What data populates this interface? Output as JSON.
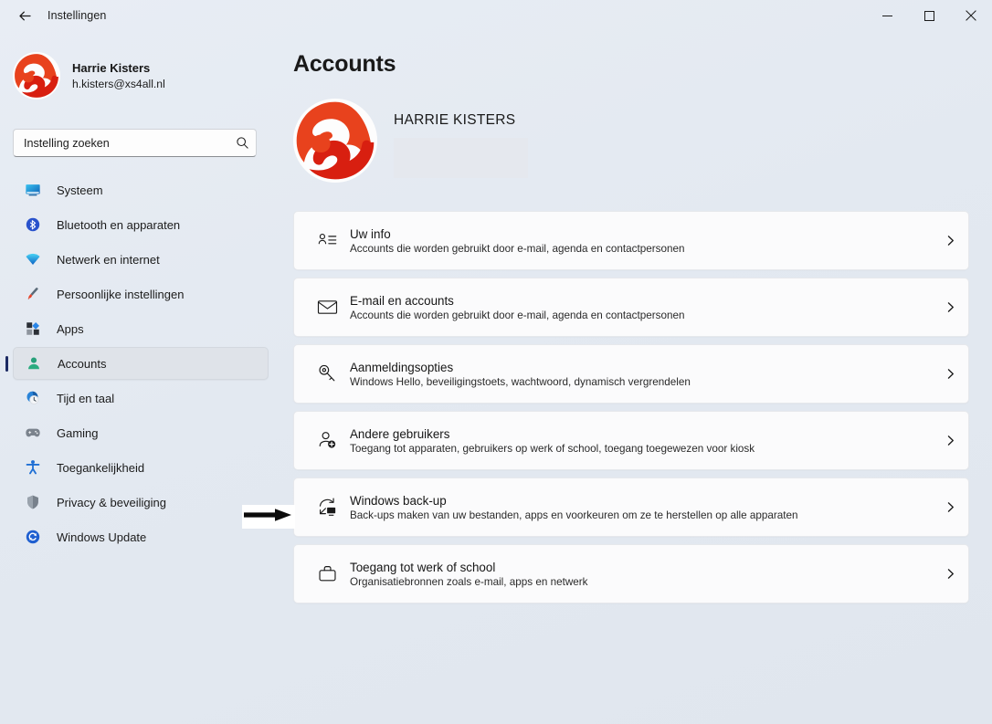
{
  "window": {
    "title": "Instellingen",
    "back_icon": "back-arrow-icon",
    "minimize_label": "Minimaliseren",
    "maximize_label": "Maximaliseren",
    "close_label": "Sluiten"
  },
  "sidebar": {
    "account": {
      "name": "Harrie Kisters",
      "email": "h.kisters@xs4all.nl",
      "avatar_icon": "user-avatar-logo"
    },
    "search": {
      "placeholder": "Instelling zoeken",
      "value": "",
      "icon": "search-icon"
    },
    "items": [
      {
        "label": "Systeem",
        "icon": "monitor-icon",
        "selected": false
      },
      {
        "label": "Bluetooth en apparaten",
        "icon": "bluetooth-icon",
        "selected": false
      },
      {
        "label": "Netwerk en internet",
        "icon": "wifi-icon",
        "selected": false
      },
      {
        "label": "Persoonlijke instellingen",
        "icon": "paintbrush-icon",
        "selected": false
      },
      {
        "label": "Apps",
        "icon": "apps-grid-icon",
        "selected": false
      },
      {
        "label": "Accounts",
        "icon": "person-icon",
        "selected": true
      },
      {
        "label": "Tijd en taal",
        "icon": "clock-globe-icon",
        "selected": false
      },
      {
        "label": "Gaming",
        "icon": "gamepad-icon",
        "selected": false
      },
      {
        "label": "Toegankelijkheid",
        "icon": "accessibility-icon",
        "selected": false
      },
      {
        "label": "Privacy & beveiliging",
        "icon": "shield-icon",
        "selected": false
      },
      {
        "label": "Windows Update",
        "icon": "update-refresh-icon",
        "selected": false
      }
    ]
  },
  "main": {
    "page_title": "Accounts",
    "profile": {
      "display_name": "HARRIE KISTERS",
      "avatar_icon": "user-avatar-logo",
      "redacted": true
    },
    "cards": [
      {
        "title": "Uw info",
        "subtitle": "Accounts die worden gebruikt door e-mail, agenda en contactpersonen",
        "icon": "user-info-icon",
        "chevron": "chevron-right-icon"
      },
      {
        "title": "E-mail en accounts",
        "subtitle": "Accounts die worden gebruikt door e-mail, agenda en contactpersonen",
        "icon": "envelope-icon",
        "chevron": "chevron-right-icon"
      },
      {
        "title": "Aanmeldingsopties",
        "subtitle": "Windows Hello, beveiligingstoets, wachtwoord, dynamisch vergrendelen",
        "icon": "key-icon",
        "chevron": "chevron-right-icon"
      },
      {
        "title": "Andere gebruikers",
        "subtitle": "Toegang tot apparaten, gebruikers op werk of school, toegang toegewezen voor kiosk",
        "icon": "add-user-icon",
        "chevron": "chevron-right-icon"
      },
      {
        "title": "Windows back-up",
        "subtitle": "Back-ups maken van uw bestanden, apps en voorkeuren om ze te herstellen op alle apparaten",
        "icon": "backup-restore-icon",
        "chevron": "chevron-right-icon"
      },
      {
        "title": "Toegang tot werk of school",
        "subtitle": "Organisatiebronnen zoals e-mail, apps en netwerk",
        "icon": "briefcase-icon",
        "chevron": "chevron-right-icon"
      }
    ]
  },
  "annotation": {
    "arrow_icon": "annotation-arrow-icon",
    "points_to": "Windows back-up"
  },
  "colors": {
    "background": "#e4eaf2",
    "card": "#fbfbfc",
    "accent": "#1c2a63",
    "logo_orange": "#e8421d",
    "logo_red": "#d81f10",
    "selected_pill": "#dfe3e9"
  }
}
